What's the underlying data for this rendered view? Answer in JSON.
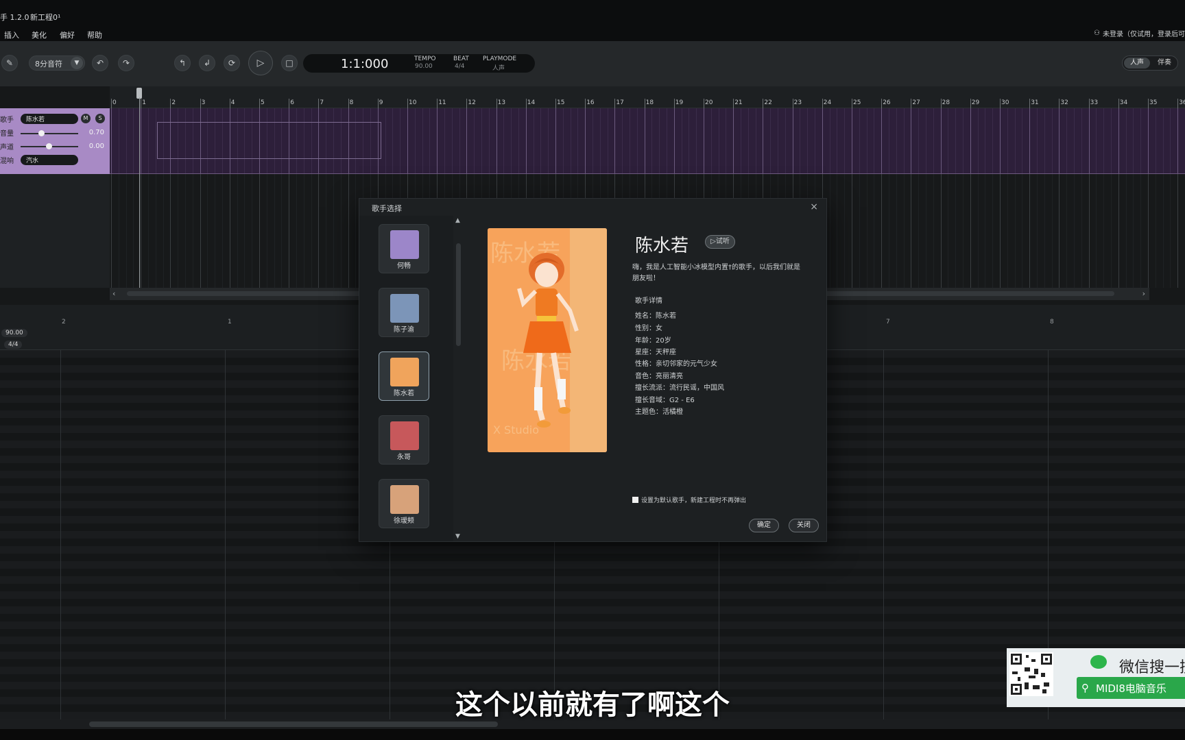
{
  "titlebar": {
    "app_version": "手 1.2.0",
    "project": "新工程0¹"
  },
  "menu": [
    "插入",
    "美化",
    "偏好",
    "帮助"
  ],
  "login": {
    "text": "未登录（仅试用，登录后可"
  },
  "toolbar": {
    "note_length": "8分音符",
    "time": "1:1:000",
    "tempo_label": "TEMPO",
    "tempo_value": "90.00",
    "beat_label": "BEAT",
    "beat_value": "4/4",
    "playmode_label": "PLAYMODE",
    "playmode_value": "人声",
    "mode_vocal": "人声",
    "mode_accomp": "伴奏"
  },
  "ruler": {
    "numbers": [
      "0",
      "1",
      "2",
      "3",
      "4",
      "5",
      "6",
      "7",
      "8",
      "9",
      "10",
      "11",
      "12",
      "13",
      "14",
      "15",
      "16",
      "17",
      "18",
      "19",
      "20",
      "21",
      "22",
      "23",
      "24",
      "25",
      "26",
      "27",
      "28",
      "29",
      "30",
      "31",
      "32",
      "33",
      "34",
      "35",
      "36"
    ]
  },
  "track": {
    "singer_label": "歌手",
    "singer_value": "陈水若",
    "volume_label": "音量",
    "volume_value": "0.70",
    "volume_level": 0.7,
    "pan_label": "声道",
    "pan_value": "0.00",
    "style_label": "混响",
    "style_value": "汽水",
    "m_label": "M",
    "s_label": "S"
  },
  "roll": {
    "tempo_tag": "90.00",
    "beat_tag": "4/4",
    "bar_labels": [
      "2",
      "1",
      "7",
      "8"
    ]
  },
  "dialog": {
    "title": "歌手选择",
    "close_icon": "×",
    "singers": [
      {
        "name": "何畅",
        "color": "#9c86c9"
      },
      {
        "name": "陈子渝",
        "color": "#7c95b8"
      },
      {
        "name": "陈水若",
        "color": "#f0a45c"
      },
      {
        "name": "永哥",
        "color": "#c7585b"
      },
      {
        "name": "徐瑷颊",
        "color": "#d7a27a"
      }
    ],
    "selected_name": "陈水若",
    "listen_label": "▷试听",
    "intro": "嗨，我是人工智能小冰模型内置†的歌手，以后我们就是朋友啦！",
    "details_heading": "歌手详情",
    "details": [
      "姓名：陈水若",
      "性别：女",
      "年龄：20岁",
      "星座：天秤座",
      "性格：亲切邻家的元气少女",
      "音色：亮丽清亮",
      "擅长流派：流行民谣，中国风",
      "擅长音域：G2 - E6",
      "主题色：活橘橙"
    ],
    "default_checkbox": "设置为默认歌手，新建工程时不再弹出",
    "ok_label": "确定",
    "close_label": "关闭",
    "portrait_watermark": [
      "陈水若",
      "X Studio"
    ]
  },
  "subtitle": "这个以前就有了啊这个",
  "wechat": {
    "line1": "微信搜一搜",
    "line2": "MIDI8电脑音乐"
  },
  "colors": {
    "track": "#a88ac5",
    "lane": "#2d1f3a",
    "portrait": "#f7a35b",
    "wechat_green": "#2aa74a"
  }
}
